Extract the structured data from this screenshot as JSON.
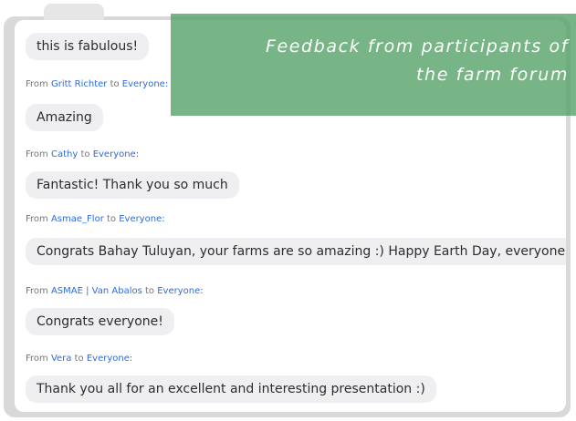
{
  "overlay": {
    "title_line1": "Feedback from participants of",
    "title_line2": "the farm forum"
  },
  "chat": {
    "messages": [
      {
        "text": "this is fabulous!"
      },
      {
        "from_prefix": "From",
        "sender": "Gritt Richter",
        "to_word": "to",
        "recipient": "Everyone:",
        "text": "Amazing"
      },
      {
        "from_prefix": "From",
        "sender": "Cathy",
        "to_word": "to",
        "recipient": "Everyone:",
        "text": "Fantastic! Thank you so much"
      },
      {
        "from_prefix": "From",
        "sender": "Asmae_Flor",
        "to_word": "to",
        "recipient": "Everyone:",
        "text": "Congrats Bahay Tuluyan, your farms are so amazing :) Happy Earth Day, everyone!"
      },
      {
        "from_prefix": "From",
        "sender": "ASMAE | Van Abalos",
        "to_word": "to",
        "recipient": "Everyone:",
        "text": "Congrats everyone!"
      },
      {
        "from_prefix": "From",
        "sender": "Vera",
        "to_word": "to",
        "recipient": "Everyone:",
        "text": "Thank you all for an excellent and interesting presentation :)"
      }
    ]
  }
}
